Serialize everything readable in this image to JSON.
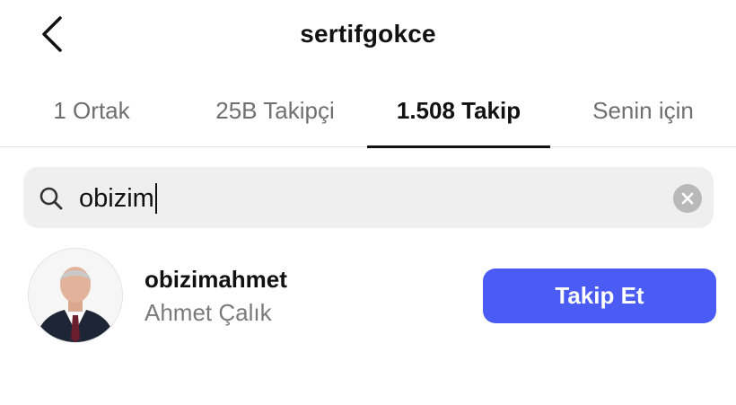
{
  "header": {
    "title": "sertifgokce",
    "back_icon": "chevron-left-icon"
  },
  "tabs": [
    {
      "label": "1 Ortak",
      "active": false
    },
    {
      "label": "25B Takipçi",
      "active": false
    },
    {
      "label": "1.508 Takip",
      "active": true
    },
    {
      "label": "Senin için",
      "active": false
    }
  ],
  "search": {
    "value": "obizim",
    "icon": "search-icon",
    "clear_icon": "clear-icon"
  },
  "results": [
    {
      "username": "obizimahmet",
      "full_name": "Ahmet Çalık",
      "button_label": "Takip Et"
    }
  ],
  "colors": {
    "accent": "#4a5cf4",
    "muted_text": "#7a7a7a",
    "search_bg": "#efefef"
  }
}
